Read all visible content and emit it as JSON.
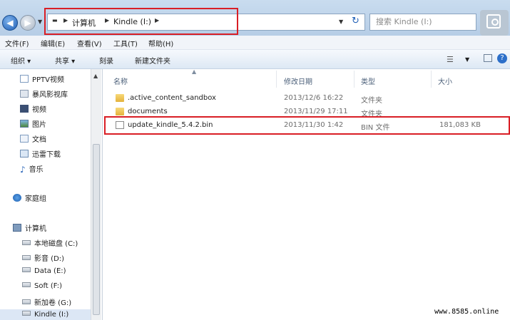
{
  "address": {
    "crumbs": [
      "计算机",
      "Kindle (I:)"
    ]
  },
  "search": {
    "placeholder": "搜索 Kindle (I:)"
  },
  "menubar": [
    "文件(F)",
    "编辑(E)",
    "查看(V)",
    "工具(T)",
    "帮助(H)"
  ],
  "toolbar": {
    "organize": "组织 ▾",
    "share": "共享 ▾",
    "burn": "刻录",
    "new_folder": "新建文件夹"
  },
  "nav": {
    "favorites": [
      "PPTV视频",
      "暴风影视库",
      "视频",
      "图片",
      "文档",
      "迅雷下载",
      "音乐"
    ],
    "homegroup": "家庭组",
    "computer": "计算机",
    "drives": [
      "本地磁盘 (C:)",
      "影音 (D:)",
      "Data (E:)",
      "Soft (F:)",
      "新加卷 (G:)",
      "Kindle (I:)"
    ]
  },
  "columns": {
    "name": "名称",
    "modified": "修改日期",
    "type": "类型",
    "size": "大小"
  },
  "files": [
    {
      "name": ".active_content_sandbox",
      "modified": "2013/12/6 16:22",
      "type": "文件夹",
      "size": "",
      "icon": "folder-icon"
    },
    {
      "name": "documents",
      "modified": "2013/11/29 17:11",
      "type": "文件夹",
      "size": "",
      "icon": "folder-icon"
    },
    {
      "name": "update_kindle_5.4.2.bin",
      "modified": "2013/11/30 1:42",
      "type": "BIN 文件",
      "size": "181,083 KB",
      "icon": "bin-file-icon"
    }
  ],
  "watermark": "www.8585.online",
  "colors": {
    "highlight": "#d91e25",
    "titlebar": "#c9dcef"
  }
}
